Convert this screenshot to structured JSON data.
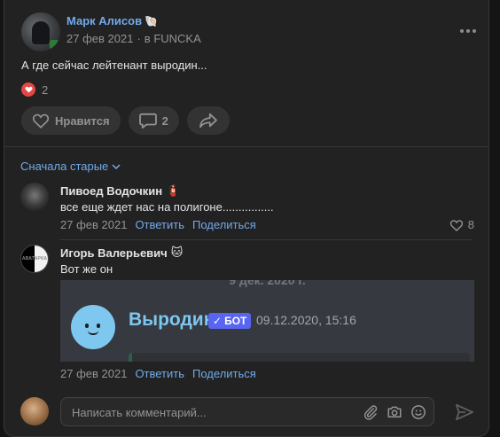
{
  "post": {
    "author": "Марк Алисов",
    "author_emoji": "🐚",
    "date": "27 фев 2021",
    "group_prefix": "в",
    "group": "FUNCKA",
    "text": "А где сейчас лейтенант выродин...",
    "reactions_count": "2",
    "like_label": "Нравится",
    "comments_count": "2"
  },
  "comments_sort": "Сначала старые",
  "comments": [
    {
      "name": "Пивоед Водочкин",
      "emoji": "🧯",
      "text": "все еще ждет нас на полигоне................",
      "date": "27 фев 2021",
      "reply": "Ответить",
      "share": "Поделиться",
      "likes": "8"
    },
    {
      "name": "Игорь Валерьевич",
      "emoji": "🐱",
      "avatar_text": "АВАТАРКА",
      "text": "Вот же он",
      "date": "27 фев 2021",
      "reply": "Ответить",
      "share": "Поделиться",
      "attachment": {
        "date_cut": "9 дек. 2020 г.",
        "bot_name": "Выродин",
        "bot_tag": "БОТ",
        "timestamp": "09.12.2020, 15:16"
      }
    }
  ],
  "composer": {
    "placeholder": "Написать комментарий..."
  },
  "colors": {
    "background": "#222222",
    "link": "#71aaeb",
    "like_red": "#e64646",
    "discord_bg": "#36393f",
    "bot_blue": "#7ec7ef",
    "bot_tag": "#5865f2"
  }
}
